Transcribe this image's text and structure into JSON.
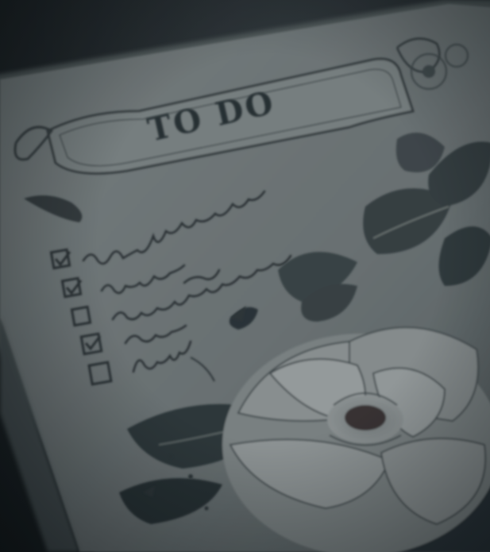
{
  "header": {
    "title": "TO DO"
  },
  "colors": {
    "paper": "#7e8686",
    "paper_shadow": "#5f6869",
    "ink": "#2e3538",
    "background": "#1f2528",
    "petal": "#9aa1a1",
    "leaf": "#3c4649"
  },
  "checklist": {
    "items": [
      {
        "checked": true
      },
      {
        "checked": true
      },
      {
        "checked": false
      },
      {
        "checked": true
      },
      {
        "checked": false
      }
    ]
  }
}
